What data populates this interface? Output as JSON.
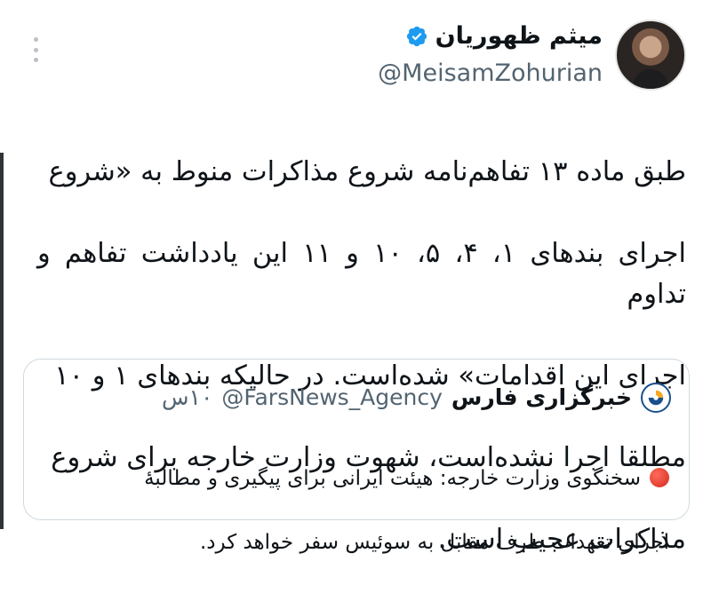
{
  "tweet": {
    "author": {
      "display_name": "میثم ظهوریان",
      "handle": "@MeisamZohurian",
      "verified": true
    },
    "body_lines": [
      "طبق ماده ۱۳ تفاهم‌نامه شروع مذاکرات منوط به «شروع",
      "اجرای بندهای ۱، ۴، ۵، ۱۰ و ۱۱ این یادداشت تفاهم و تداوم",
      "اجرای این اقدامات» شده‌است. در حالیکه بندهای ۱ و ۱۰",
      "مطلقا اجرا نشده‌است، شهوت وزارت خارجه برای شروع",
      "مذاکرات عجیب است."
    ],
    "more_icon": "more-vertical-icon"
  },
  "quote": {
    "display_name": "خبرگزاری فارس",
    "handle": "@FarsNews_Agency",
    "time": "۱۰س",
    "emoji": "red-circle-icon",
    "text_lines": [
      "سخنگوی وزارت خارجه: هیئت ایرانی برای پیگیری و مطالبهٔ",
      "اجرای تعهدات طرف مقابل به سوئیس سفر خواهد کرد."
    ]
  },
  "colors": {
    "text": "#0f1419",
    "secondary": "#536471",
    "verified": "#1d9bf0",
    "border": "#cfd9de",
    "fars_orange": "#f5a623",
    "fars_blue": "#1a4f8b"
  }
}
